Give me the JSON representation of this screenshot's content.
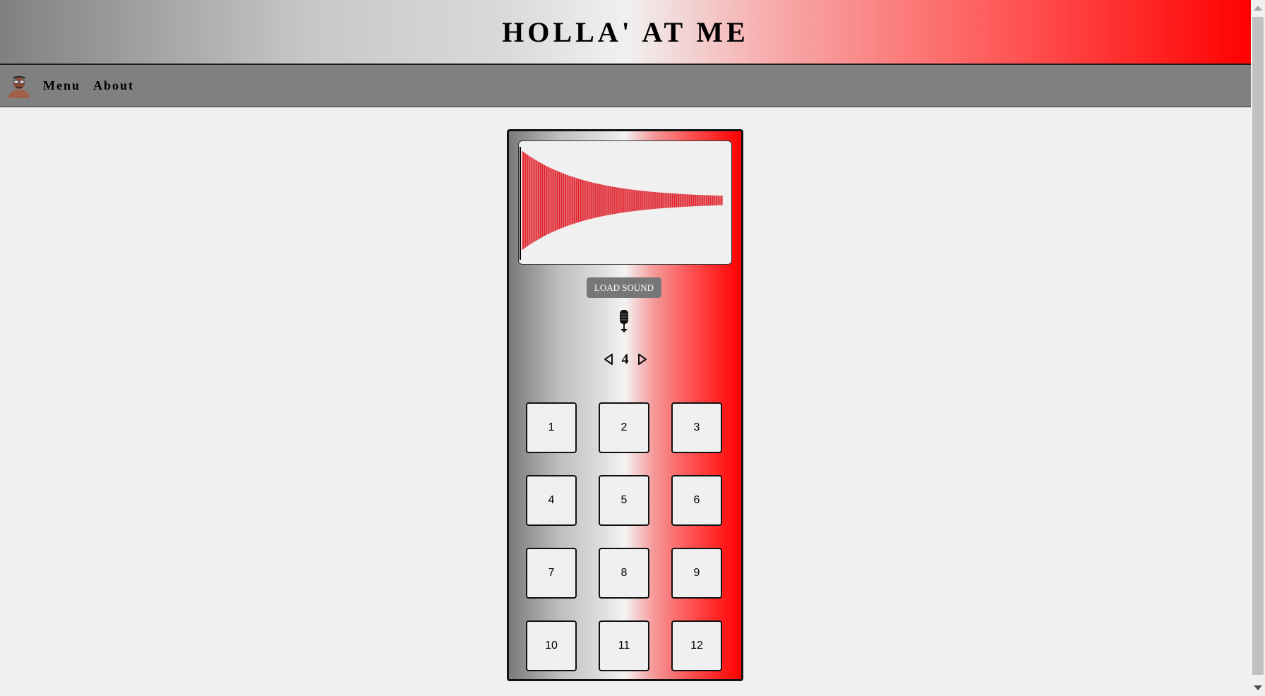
{
  "header": {
    "title": "HOLLA' AT ME"
  },
  "nav": {
    "avatar_icon": "avatar-person-icon",
    "items": [
      {
        "label": "Menu"
      },
      {
        "label": "About"
      }
    ]
  },
  "sampler": {
    "load_label": "LOAD SOUND",
    "mic_icon": "microphone-icon",
    "bank": {
      "value": "4",
      "prev_icon": "triangle-left-icon",
      "next_icon": "triangle-right-icon"
    },
    "pads": [
      {
        "label": "1"
      },
      {
        "label": "2"
      },
      {
        "label": "3"
      },
      {
        "label": "4"
      },
      {
        "label": "5"
      },
      {
        "label": "6"
      },
      {
        "label": "7"
      },
      {
        "label": "8"
      },
      {
        "label": "9"
      },
      {
        "label": "10"
      },
      {
        "label": "11"
      },
      {
        "label": "12"
      }
    ],
    "waveform_color": "#e0202a"
  },
  "colors": {
    "accent_red": "#ff0000",
    "nav_gray": "#808080",
    "background": "#f0f0f0"
  }
}
